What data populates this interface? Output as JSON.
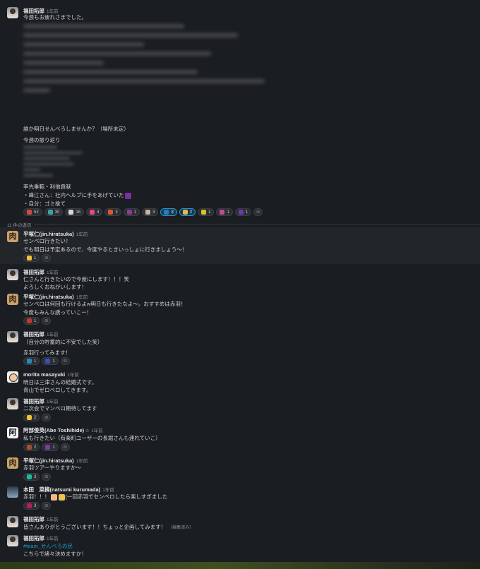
{
  "parent": {
    "author": "福田拓郎",
    "time": "1年前",
    "greeting": "今週もお疲れさまでした。",
    "invite": "誰か明日せんべろしませんか？（場所未定）",
    "review_heading": "今週の振り返り",
    "rebuild_heading": "率先垂範・利他貢献",
    "bullet1_prefix": "・峰江さん：社内ヘルプに手をあげていた",
    "bullet2": "・自分：ゴミ捨て",
    "reactions": [
      {
        "emoji": "fire",
        "color": "#d94848",
        "count": "52"
      },
      {
        "emoji": "tada",
        "color": "#3aa3a3",
        "count": "30"
      },
      {
        "emoji": "man-bowing",
        "color": "#d8d8d8",
        "count": "16"
      },
      {
        "emoji": "heart-eyes",
        "color": "#e84a76",
        "count": "4"
      },
      {
        "emoji": "flame-text",
        "color": "#e1552b",
        "count": "3"
      },
      {
        "emoji": "purple-badge",
        "color": "#8e3a9a",
        "count": "1"
      },
      {
        "emoji": "building",
        "color": "#c7b59a",
        "count": "3"
      },
      {
        "emoji": "blue-badge",
        "color": "#2e7bb8",
        "count": "3",
        "mine": true
      },
      {
        "emoji": "yellow-box",
        "color": "#e8b84a",
        "count": "2",
        "mine": true
      },
      {
        "emoji": "yellow-badge",
        "color": "#d6c42b",
        "count": "1"
      },
      {
        "emoji": "pink-badge",
        "color": "#c34a8c",
        "count": "1"
      },
      {
        "emoji": "violet-badge",
        "color": "#6a3ab0",
        "count": "1"
      }
    ]
  },
  "thread": {
    "replies_label": "11 件の返信"
  },
  "replies": [
    {
      "author": "平塚仁(jin.hiratsuka)",
      "time": "1年前",
      "avatar": "肉",
      "lines": [
        "センベロ行きたい！",
        "でも明日は予定あるので、今度やるときいっしょに行きましょう〜！"
      ],
      "reactions": [
        {
          "emoji": "grin",
          "color": "#f1c232",
          "count": "1"
        }
      ]
    },
    {
      "author": "福田拓郎",
      "time": "1年前",
      "lines": [
        "仁さんと行きたいので今度にします！！！笑",
        "よろしくおねがいします！"
      ],
      "reactions": []
    },
    {
      "author": "平塚仁(jin.hiratsuka)",
      "time": "1年前",
      "avatar": "肉",
      "lines": [
        "センベロは何回も行けるよw明日も行きたなよ〜。おすすめは赤羽！",
        "今度もみんな誘っていこー！"
      ],
      "reactions": [
        {
          "emoji": "red-badge",
          "color": "#c0392b",
          "count": "1"
        }
      ]
    },
    {
      "author": "福田拓郎",
      "time": "1年前",
      "lines": [
        "（自分の貯蓄的に不安でした笑）",
        "赤羽行ってみます！"
      ],
      "reactions": [
        {
          "emoji": "dots",
          "color": "#2e86c1",
          "count": "1"
        },
        {
          "emoji": "blue-face",
          "color": "#3b4fb5",
          "count": "1"
        }
      ]
    },
    {
      "author": "morita masayuki",
      "time": "1年前",
      "lines": [
        "明日は三津さんの結婚式です。",
        "青山でゼロベロしてきます。"
      ],
      "reactions": []
    },
    {
      "author": "福田拓郎",
      "time": "1年前",
      "lines": [
        "二次会でマンベロ期待してます"
      ],
      "reactions": [
        {
          "emoji": "thumbsup",
          "color": "#f1c232",
          "count": "2"
        }
      ]
    },
    {
      "author": "阿部俊英(Abe Toshihide)",
      "time": "1年前",
      "avatar": "阿",
      "lines": [
        "私も行きたい（有楽町ユーザーの長堀さんも連れていこ）"
      ],
      "reactions": [
        {
          "emoji": "brown-badge",
          "color": "#a0522d",
          "count": "2"
        },
        {
          "emoji": "purple-badge",
          "color": "#7d3c98",
          "count": "1"
        }
      ]
    },
    {
      "author": "平塚仁(jin.hiratsuka)",
      "time": "1年前",
      "avatar": "肉",
      "lines": [
        "赤羽ツアーやりますか〜"
      ],
      "reactions": [
        {
          "emoji": "teal-badge",
          "color": "#1abc9c",
          "count": "3"
        }
      ]
    },
    {
      "author": "本田　菜摘(natsumi kurumada)",
      "time": "1年前",
      "line_prefix": "赤羽！！！",
      "line_suffix": "(一回赤羽でセンベロしたら楽しすぎました",
      "reactions": [
        {
          "emoji": "magenta-badge",
          "color": "#c2185b",
          "count": "3"
        }
      ]
    },
    {
      "author": "福田拓郎",
      "time": "1年前",
      "lines": [
        "皆さんありがとうございます！！ちょっと企画してみます！"
      ],
      "edited": "（編集済み）",
      "reactions": []
    },
    {
      "author": "福田拓郎",
      "time": "1年前",
      "channel": "#team_せんべろの民",
      "lines": [
        "こちらで諸々決めますか！"
      ],
      "reactions": []
    }
  ],
  "ui": {
    "add_reaction_icon": "add-reaction-icon",
    "status_icon": "phone-icon"
  }
}
